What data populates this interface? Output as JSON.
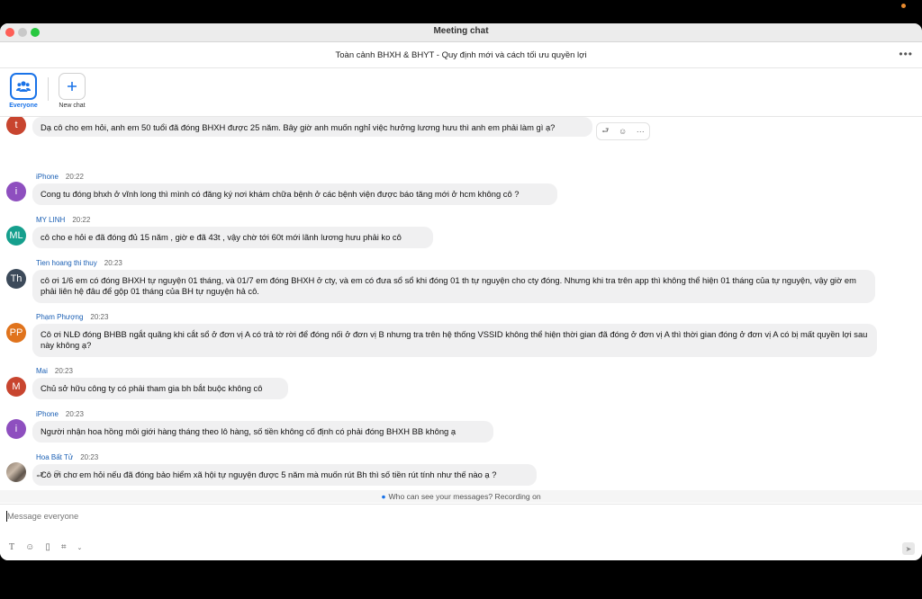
{
  "window": {
    "title": "Meeting chat",
    "meeting_title": "Toàn cảnh BHXH & BHYT - Quy định mới và cách tối ưu quyền lợi"
  },
  "tabs": [
    {
      "label": "Everyone",
      "active": true,
      "icon": "people-icon"
    },
    {
      "label": "New chat",
      "active": false,
      "icon": "plus-icon"
    }
  ],
  "messages": [
    {
      "initials": "t",
      "color": "#c8452f",
      "sender": "",
      "time": "",
      "text": "Dạ cô cho em hỏi, anh em 50 tuổi đã đóng BHXH được 25 năm. Bây giờ anh muốn nghỉ việc hưởng lương hưu thì anh em phải làm gì ạ?"
    },
    {
      "initials": "i",
      "color": "#8e4fbf",
      "sender": "iPhone",
      "time": "20:22",
      "text": "Cong tu đóng bhxh ở vĩnh long thì mình có đăng ký nơi khám chữa bệnh ở các bệnh viện được báo tăng mới ở hcm không cô ?"
    },
    {
      "initials": "ML",
      "color": "#159f8d",
      "sender": "MY LINH",
      "time": "20:22",
      "text": "cô cho e hỏi e đã đóng đủ 15 năm , giờ e đã 43t , vậy chờ tới 60t mới lãnh lương hưu phải ko cô"
    },
    {
      "initials": "Th",
      "color": "#3c4a5a",
      "sender": "Tien hoang thi thuy",
      "time": "20:23",
      "text": "cô ơi 1/6 em có đóng BHXH tự nguyện 01 tháng, và 01/7 em đóng BHXH ở cty, và em có đưa sổ sổ khi đóng 01 th tự nguyện cho cty đóng. Nhưng khi tra trên app thì không thể hiện 01 tháng của tự nguyện, vậy giờ em phải liên hệ đâu để gộp 01 tháng của BH tự nguyện hả cô."
    },
    {
      "initials": "PP",
      "color": "#e0731c",
      "sender": "Phạm Phượng",
      "time": "20:23",
      "text": "Cô ơi NLĐ đóng BHBB ngắt quãng khi cắt sổ ở đơn vị A có trả tờ rời để đóng nối ở đơn vị B nhưng tra trên hệ thống VSSID không thể hiện thời gian đã đóng ở đơn vị A thì thời gian đóng ở đơn vị A có bị mất quyền lợi sau này không ạ?"
    },
    {
      "initials": "M",
      "color": "#c8452f",
      "sender": "Mai",
      "time": "20:23",
      "text": "Chủ sở hữu công ty có phải tham gia bh bắt buộc không cô"
    },
    {
      "initials": "i",
      "color": "#8e4fbf",
      "sender": "iPhone",
      "time": "20:23",
      "text": "Người nhận hoa hồng môi giới hàng tháng theo lô hàng, số tiền không cố định có phải đóng BHXH BB không ạ"
    },
    {
      "initials": "",
      "color": "#8a7a6a",
      "sender": "Hoa Bất Tử",
      "time": "20:23",
      "text": "Cô ơi cho em hỏi nếu đã đóng bảo hiểm xã hội tự nguyện được 5 năm mà muốn rút Bh  thì số tiền rút tính như thế nào ạ ?"
    }
  ],
  "notice": "Who can see your messages? Recording on",
  "compose": {
    "placeholder": "Message everyone"
  }
}
